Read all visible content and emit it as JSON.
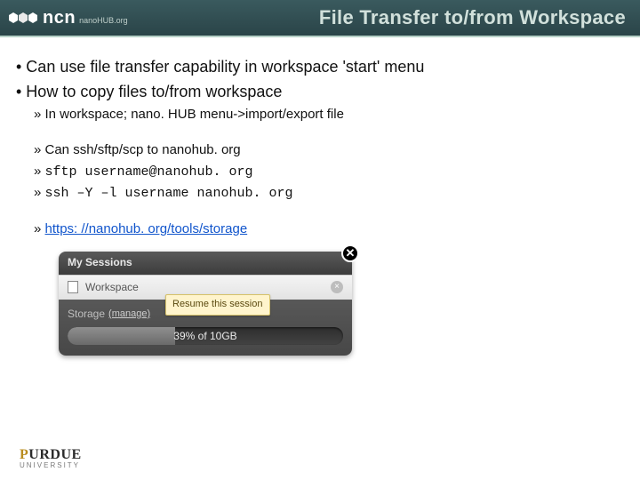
{
  "header": {
    "brand_main": "ncn",
    "brand_sub": "nanoHUB.org",
    "title": "File Transfer to/from Workspace"
  },
  "body": {
    "b1": "• Can use file transfer capability in workspace 'start' menu",
    "b2": "• How to copy files to/from workspace",
    "s1": "» In workspace; nano. HUB menu->import/export file",
    "s2": "» Can ssh/sftp/scp to nanohub. org",
    "s3_prefix": "» ",
    "s3_code": "sftp username@nanohub. org",
    "s4_prefix": "» ",
    "s4_code": "ssh –Y –l username nanohub. org",
    "s5_prefix": "» ",
    "s5_link": "https: //nanohub. org/tools/storage"
  },
  "widget": {
    "title": "My Sessions",
    "row_label": "Workspace",
    "storage_label": "Storage",
    "manage": "(manage)",
    "tooltip": "Resume this session",
    "bar_text": "39% of 10GB",
    "fill_percent": 39
  },
  "footer": {
    "purdue_p": "P",
    "purdue_rest": "URDUE",
    "university": "UNIVERSITY"
  }
}
